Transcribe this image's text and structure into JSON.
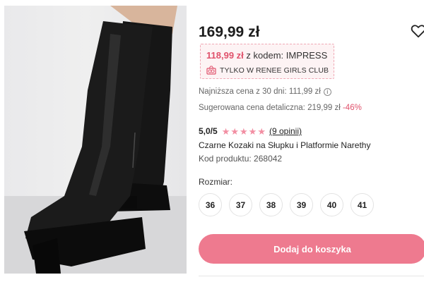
{
  "product": {
    "price": "169,99 zł",
    "promo": {
      "price": "118,99 zł",
      "code_text": "z kodem: IMPRESS",
      "club_text": "TYLKO W RENEE GIRLS CLUB"
    },
    "lowest_price_text": "Najniższa cena z 30 dni: 111,99 zł",
    "suggested_price_text": "Sugerowana cena detaliczna: 219,99 zł",
    "discount": "-46%",
    "rating": {
      "score": "5,0/5",
      "stars": 5,
      "reviews": "(9 opinii)"
    },
    "name": "Czarne Kozaki na Słupku i Platformie Narethy",
    "code": "Kod produktu: 268042",
    "size_label": "Rozmiar:",
    "sizes": [
      "36",
      "37",
      "38",
      "39",
      "40",
      "41"
    ],
    "cart_button": "Dodaj do koszyka"
  },
  "icons": {
    "heart": "heart-icon",
    "club": "gift-icon",
    "info": "info-icon"
  },
  "colors": {
    "accent": "#e0516b",
    "button": "#ee7a8f",
    "promo_bg": "#fdf3f4",
    "star": "#f28ea2"
  }
}
